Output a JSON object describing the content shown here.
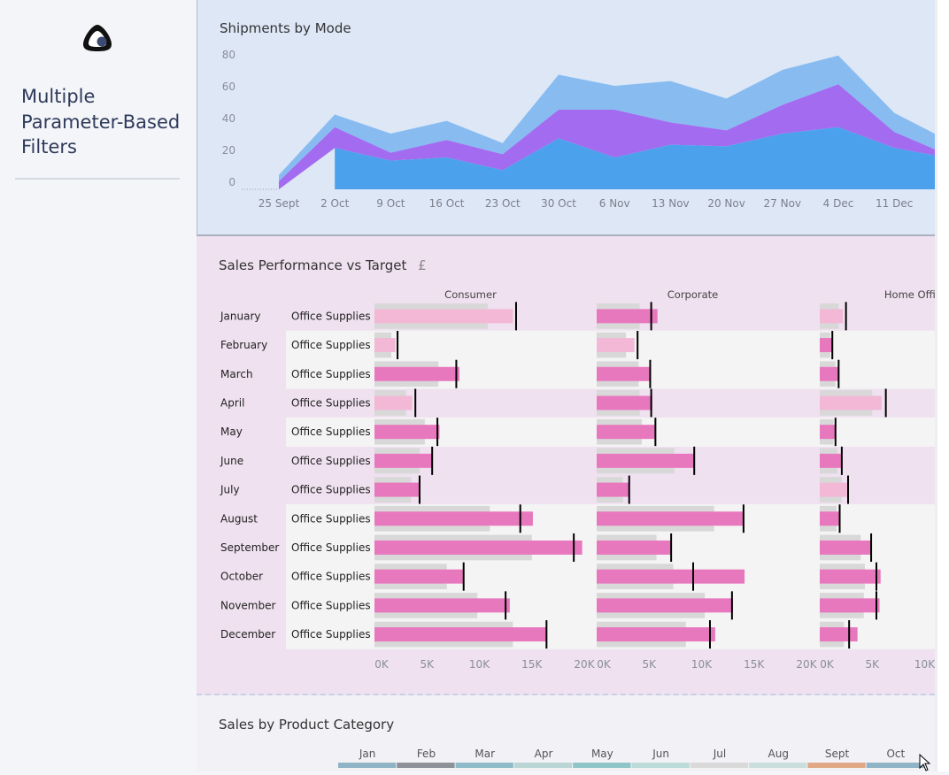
{
  "sidebar": {
    "title": "Multiple Parameter-Based Filters",
    "logo_icon": "tableau-dashboard-logo-icon"
  },
  "shipments": {
    "title": "Shipments by Mode",
    "chart_data": {
      "type": "area",
      "title": "Shipments by Mode",
      "categories": [
        "25 Sept",
        "2 Oct",
        "9 Oct",
        "16 Oct",
        "23 Oct",
        "30 Oct",
        "6 Nov",
        "13 Nov",
        "20 Nov",
        "27 Nov",
        "4 Dec",
        "11 Dec"
      ],
      "yticks": [
        "80",
        "60",
        "40",
        "20",
        "0"
      ],
      "ylim": [
        0,
        85
      ],
      "stacked": true,
      "series": [
        {
          "color": "#4ba1ec",
          "values": [
            0,
            26,
            18,
            20,
            12,
            32,
            20,
            28,
            27,
            35,
            39,
            26
          ]
        },
        {
          "color": "#a36cf0",
          "values": [
            5,
            13,
            5,
            11,
            10,
            18,
            30,
            14,
            10,
            18,
            27,
            10
          ]
        },
        {
          "color": "#88bcf1",
          "values": [
            4,
            8,
            12,
            12,
            7,
            22,
            15,
            26,
            20,
            22,
            18,
            12
          ]
        }
      ]
    }
  },
  "sales": {
    "title": "Sales Performance vs Target",
    "currency": "£",
    "category_label": "Office Supplies",
    "months": [
      "January",
      "February",
      "March",
      "April",
      "May",
      "June",
      "July",
      "August",
      "September",
      "October",
      "November",
      "December"
    ],
    "segments": [
      "Consumer",
      "Corporate",
      "Home Office"
    ],
    "axis_ticks": [
      "0K",
      "5K",
      "10K",
      "15K",
      "20K"
    ],
    "chart_data": {
      "type": "bar",
      "title": "Sales Performance vs Target",
      "xlim": [
        0,
        20000
      ],
      "panels": [
        {
          "segment": "Consumer",
          "sales": [
            13200,
            2000,
            8100,
            3600,
            6200,
            5500,
            4300,
            15100,
            19800,
            8500,
            12900,
            16400
          ],
          "target": [
            13500,
            2200,
            7800,
            3900,
            6000,
            5500,
            4300,
            13900,
            19000,
            8500,
            12500,
            16400
          ],
          "prior": [
            10800,
            1600,
            6100,
            3000,
            4800,
            4300,
            3500,
            11000,
            15000,
            6900,
            9800,
            13200
          ]
        },
        {
          "segment": "Corporate",
          "sales": [
            5800,
            3600,
            5100,
            5300,
            5600,
            9300,
            3100,
            14000,
            7100,
            14100,
            13000,
            11300
          ],
          "target": [
            5200,
            3900,
            5100,
            5200,
            5600,
            9300,
            3100,
            14000,
            7100,
            9200,
            12900,
            10800
          ],
          "prior": [
            4100,
            2800,
            4000,
            4100,
            4300,
            7400,
            2500,
            11200,
            5700,
            7300,
            10300,
            8500
          ]
        },
        {
          "segment": "Home Office",
          "sales": [
            2200,
            1200,
            1800,
            5900,
            1500,
            2100,
            2600,
            1900,
            4900,
            5800,
            5700,
            3600
          ],
          "target": [
            2500,
            1200,
            1800,
            6300,
            1500,
            2100,
            2700,
            1900,
            4900,
            5400,
            5400,
            2800
          ],
          "prior": [
            1800,
            1000,
            1500,
            5000,
            1300,
            1700,
            2100,
            1600,
            3900,
            4300,
            4200,
            2300
          ]
        }
      ],
      "light_rows": [
        0,
        3,
        5,
        6
      ]
    }
  },
  "category": {
    "title": "Sales by Product Category",
    "months": [
      "Jan",
      "Feb",
      "Mar",
      "Apr",
      "May",
      "Jun",
      "Jul",
      "Aug",
      "Sept",
      "Oct"
    ],
    "month_colors": [
      "#8fb4c5",
      "#8d9299",
      "#8fbbc8",
      "#b9d6d5",
      "#8fc4c8",
      "#bcdbd9",
      "#d9d9d9",
      "#c9dedd",
      "#e0a884",
      "#8fb4c5"
    ]
  }
}
